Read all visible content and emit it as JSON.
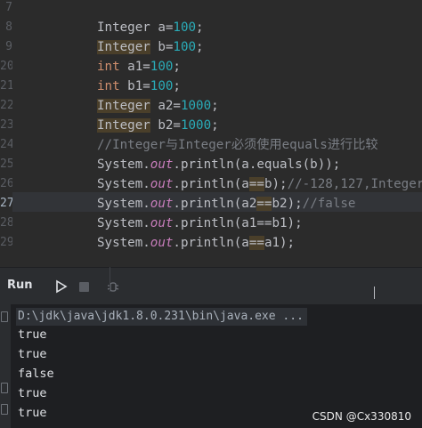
{
  "editor": {
    "line_numbers": [
      "7",
      "8",
      "9",
      "20",
      "21",
      "22",
      "23",
      "24",
      "25",
      "26",
      "27",
      "28",
      "29",
      "",
      ""
    ],
    "current_line_index": 10,
    "lines": [
      {
        "tokens": [
          {
            "t": "Integer a=",
            "c": ""
          },
          {
            "t": "100",
            "c": "num"
          },
          {
            "t": ";",
            "c": ""
          }
        ]
      },
      {
        "tokens": [
          {
            "t": "Integer",
            "c": "hl"
          },
          {
            "t": " b=",
            "c": ""
          },
          {
            "t": "100",
            "c": "num"
          },
          {
            "t": ";",
            "c": ""
          }
        ]
      },
      {
        "tokens": [
          {
            "t": "int",
            "c": "kw"
          },
          {
            "t": " a1=",
            "c": ""
          },
          {
            "t": "100",
            "c": "num"
          },
          {
            "t": ";",
            "c": ""
          }
        ]
      },
      {
        "tokens": [
          {
            "t": "int",
            "c": "kw"
          },
          {
            "t": " b1=",
            "c": ""
          },
          {
            "t": "100",
            "c": "num"
          },
          {
            "t": ";",
            "c": ""
          }
        ]
      },
      {
        "tokens": [
          {
            "t": "Integer",
            "c": "hl"
          },
          {
            "t": " a2=",
            "c": ""
          },
          {
            "t": "1000",
            "c": "num"
          },
          {
            "t": ";",
            "c": ""
          }
        ]
      },
      {
        "tokens": [
          {
            "t": "Integer",
            "c": "hl"
          },
          {
            "t": " b2=",
            "c": ""
          },
          {
            "t": "1000",
            "c": "num"
          },
          {
            "t": ";",
            "c": ""
          }
        ]
      },
      {
        "tokens": [
          {
            "t": "//Integer与Integer必须使用equals进行比较",
            "c": "cm"
          }
        ]
      },
      {
        "tokens": [
          {
            "t": "System.",
            "c": ""
          },
          {
            "t": "out",
            "c": "st"
          },
          {
            "t": ".println(a.equals(b));",
            "c": ""
          }
        ]
      },
      {
        "tokens": [
          {
            "t": "System.",
            "c": ""
          },
          {
            "t": "out",
            "c": "st"
          },
          {
            "t": ".println(a",
            "c": ""
          },
          {
            "t": "==",
            "c": "hl"
          },
          {
            "t": "b);",
            "c": ""
          },
          {
            "t": "//-128,127,Integer",
            "c": "cm"
          }
        ]
      },
      {
        "tokens": [
          {
            "t": "System.",
            "c": ""
          },
          {
            "t": "out",
            "c": "st"
          },
          {
            "t": ".println(a2",
            "c": ""
          },
          {
            "t": "==",
            "c": "hl"
          },
          {
            "t": "b2);",
            "c": ""
          },
          {
            "t": "//false",
            "c": "cm"
          }
        ]
      },
      {
        "tokens": [
          {
            "t": "System.",
            "c": ""
          },
          {
            "t": "out",
            "c": "st"
          },
          {
            "t": ".println(a1==b1);",
            "c": ""
          }
        ]
      },
      {
        "tokens": [
          {
            "t": "System.",
            "c": ""
          },
          {
            "t": "out",
            "c": "st"
          },
          {
            "t": ".println(a",
            "c": ""
          },
          {
            "t": "==",
            "c": "hl"
          },
          {
            "t": "a1);",
            "c": ""
          }
        ]
      }
    ]
  },
  "run_panel": {
    "title": "Run",
    "play_icon": "play-icon",
    "stop_icon": "stop-icon",
    "debug_icon": "debug-icon"
  },
  "console": {
    "command": "D:\\jdk\\java\\jdk1.8.0.231\\bin\\java.exe ...",
    "output": [
      "true",
      "true",
      "false",
      "true",
      "true"
    ]
  },
  "watermark": "CSDN @Cx330810"
}
